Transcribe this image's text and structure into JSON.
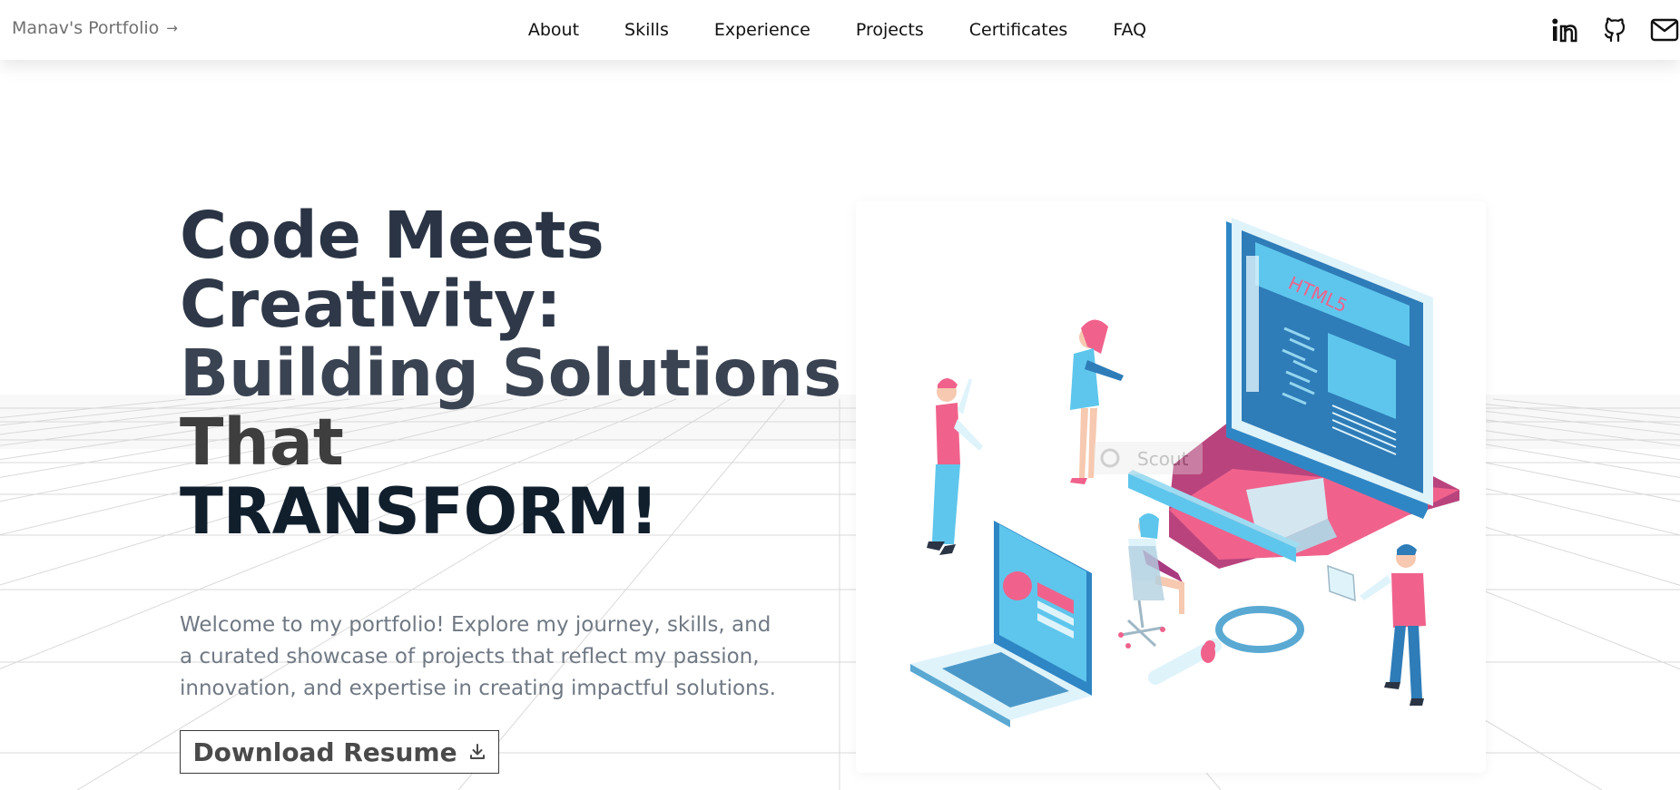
{
  "header": {
    "brand": "Manav's Portfolio",
    "nav": [
      "About",
      "Skills",
      "Experience",
      "Projects",
      "Certificates",
      "FAQ"
    ],
    "socials": [
      "linkedin-icon",
      "github-icon",
      "mail-icon"
    ]
  },
  "hero": {
    "title_lines": [
      "Code Meets",
      "Creativity:",
      "Building Solutions",
      "That",
      "TRANSFORM!"
    ],
    "intro": "Welcome to my portfolio! Explore my journey, skills, and a curated showcase of projects that reflect my passion, innovation, and expertise in creating impactful solutions.",
    "resume_label": "Download Resume"
  },
  "illustration": {
    "screen_text": "HTML5",
    "watermark": "Scout"
  },
  "colors": {
    "accent_pink": "#f0628c",
    "accent_blue": "#2f86c4",
    "light_blue": "#5ec6ec",
    "text_dark": "#2a3444",
    "text_muted": "#707984"
  }
}
